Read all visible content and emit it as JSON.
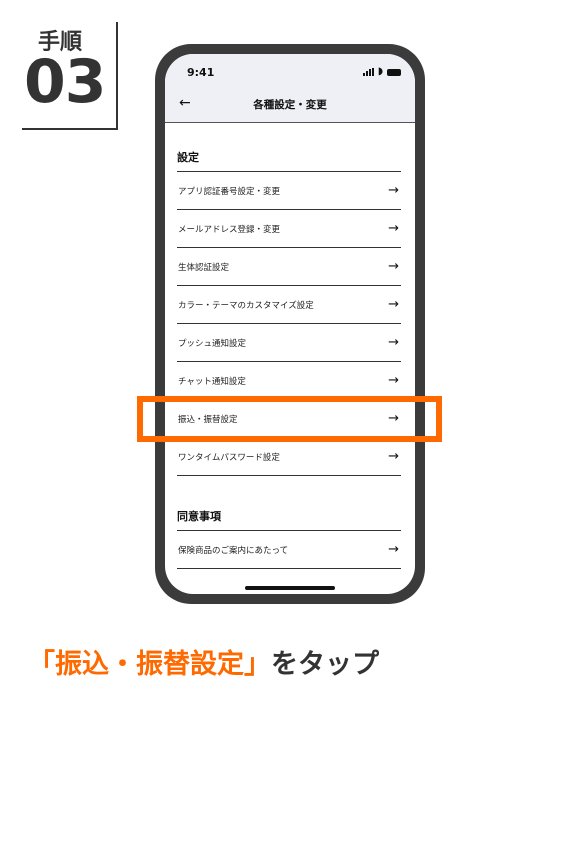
{
  "step": {
    "label": "手順",
    "number": "03"
  },
  "status_bar": {
    "time": "9:41"
  },
  "nav": {
    "title": "各種設定・変更"
  },
  "settings": {
    "title": "設定",
    "items": [
      {
        "label": "アプリ認証番号設定・変更"
      },
      {
        "label": "メールアドレス登録・変更"
      },
      {
        "label": "生体認証設定"
      },
      {
        "label": "カラー・テーマのカスタマイズ設定"
      },
      {
        "label": "プッシュ通知設定"
      },
      {
        "label": "チャット通知設定"
      },
      {
        "label": "振込・振替設定"
      },
      {
        "label": "ワンタイムパスワード設定"
      }
    ]
  },
  "consent": {
    "title": "同意事項",
    "items": [
      {
        "label": "保険商品のご案内にあたって"
      }
    ]
  },
  "caption": {
    "highlight": "「振込・振替設定」",
    "rest": "をタップ"
  },
  "colors": {
    "accent": "#ff6a00",
    "appbar": "#eef0f5"
  }
}
